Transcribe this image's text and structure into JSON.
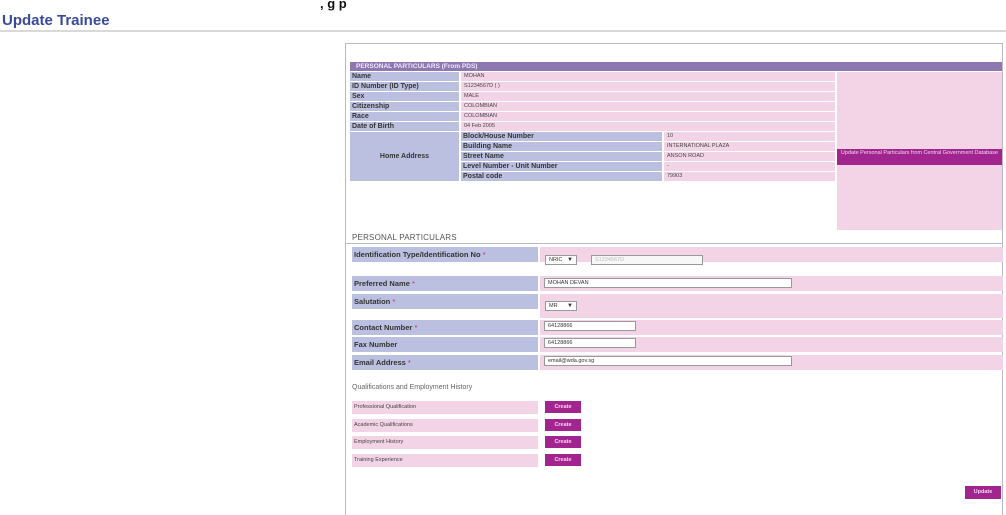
{
  "top_cut_text": ", g  p",
  "page_title": "Update Trainee",
  "pds": {
    "header": "PERSONAL PARTICULARS (From PDS)",
    "rows": [
      {
        "label": "Name",
        "value": "MOHAN"
      },
      {
        "label": "ID Number (ID Type)",
        "value": "S1234567D ( )"
      },
      {
        "label": "Sex",
        "value": "MALE"
      },
      {
        "label": "Citizenship",
        "value": "COLOMBIAN"
      },
      {
        "label": "Race",
        "value": "COLOMBIAN"
      },
      {
        "label": "Date of Birth",
        "value": "04 Feb 2005"
      }
    ],
    "home_address_label": "Home Address",
    "address": [
      {
        "label": "Block/House Number",
        "value": "10"
      },
      {
        "label": "Building Name",
        "value": "INTERNATIONAL PLAZA"
      },
      {
        "label": "Street Name",
        "value": "ANSON ROAD"
      },
      {
        "label": "Level Number - Unit Number",
        "value": "-"
      },
      {
        "label": "Postal code",
        "value": "79903"
      }
    ],
    "update_button": "Update Personal Particulars from Central Government Database"
  },
  "personal": {
    "title": "PERSONAL PARTICULARS",
    "id_type_label": "Identification Type/Identification No",
    "id_type_value": "NRIC",
    "id_number_value": "S1234567D",
    "preferred_name_label": "Preferred Name",
    "preferred_name_value": "MOHAN DEVAN",
    "salutation_label": "Salutation",
    "salutation_value": "MR",
    "contact_label": "Contact Number",
    "contact_value": "64128866",
    "fax_label": "Fax Number",
    "fax_value": "64128866",
    "email_label": "Email Address",
    "email_value": "email@wda.gov.sg",
    "required_mark": "*",
    "dropdown_arrow": "▼"
  },
  "qualifications": {
    "title": "Qualifications and Employment History",
    "rows": [
      {
        "label": "Professional Qualification",
        "button": "Create"
      },
      {
        "label": "Academic Qualifications",
        "button": "Create"
      },
      {
        "label": "Employment History",
        "button": "Create"
      },
      {
        "label": "Training Experience",
        "button": "Create"
      }
    ]
  },
  "update_button": "Update",
  "colors": {
    "title": "#3a4a9a",
    "header": "#8e78b0",
    "label_bg": "#bcc0e0",
    "value_bg": "#f2d4e6",
    "button": "#a2248e"
  }
}
